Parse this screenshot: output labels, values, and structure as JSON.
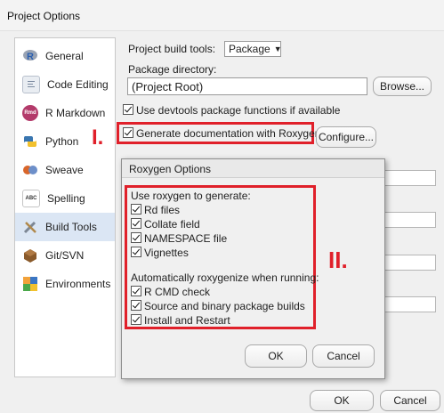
{
  "window": {
    "title": "Project Options"
  },
  "sidebar": {
    "items": [
      {
        "label": "General",
        "icon": "r-logo-icon"
      },
      {
        "label": "Code Editing",
        "icon": "code-editing-icon"
      },
      {
        "label": "R Markdown",
        "icon": "rmarkdown-icon",
        "badge": "Rmd"
      },
      {
        "label": "Python",
        "icon": "python-icon"
      },
      {
        "label": "Sweave",
        "icon": "sweave-icon"
      },
      {
        "label": "Spelling",
        "icon": "spelling-icon",
        "badge": "ABC"
      },
      {
        "label": "Build Tools",
        "icon": "build-tools-icon",
        "selected": true
      },
      {
        "label": "Git/SVN",
        "icon": "git-svn-icon"
      },
      {
        "label": "Environments",
        "icon": "environments-icon"
      }
    ]
  },
  "main": {
    "build_tools_label": "Project build tools:",
    "build_tools_value": "Package",
    "package_dir_label": "Package directory:",
    "package_dir_value": "(Project Root)",
    "browse_label": "Browse...",
    "devtools_label": "Use devtools package functions if available",
    "roxygen_label": "Generate documentation with Roxygen",
    "configure_label": "Configure..."
  },
  "annotations": {
    "one": "I.",
    "two": "II."
  },
  "roxygen_dialog": {
    "title": "Roxygen Options",
    "generate_heading": "Use roxygen to generate:",
    "generate_options": [
      "Rd files",
      "Collate field",
      "NAMESPACE file",
      "Vignettes"
    ],
    "auto_heading": "Automatically roxygenize when running:",
    "auto_options": [
      "R CMD check",
      "Source and binary package builds",
      "Install and Restart"
    ],
    "ok_label": "OK",
    "cancel_label": "Cancel"
  },
  "footer": {
    "ok_label": "OK",
    "cancel_label": "Cancel"
  },
  "colors": {
    "highlight_red": "#e0202a",
    "selected_bg": "#dbe6f4"
  }
}
